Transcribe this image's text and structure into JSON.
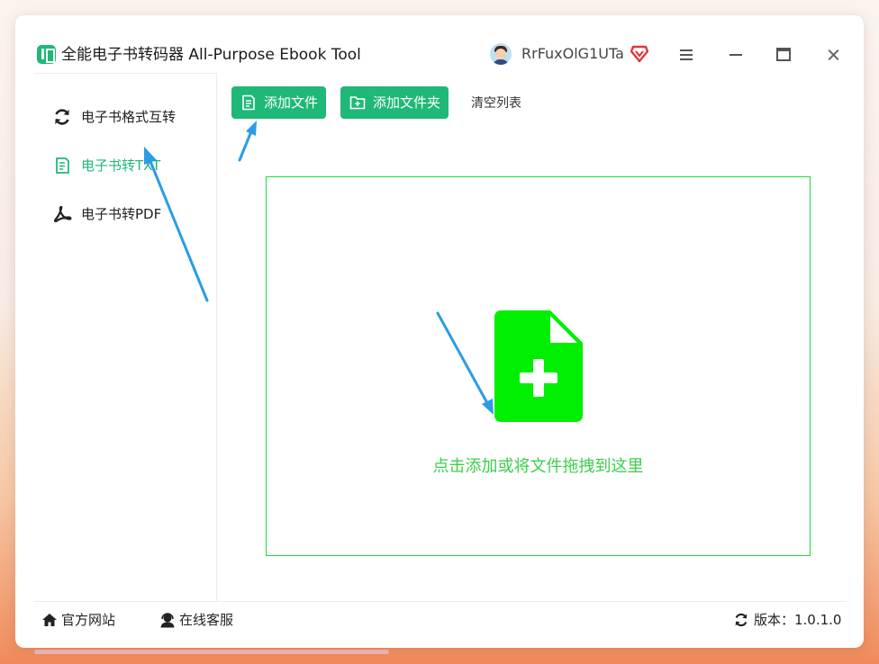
{
  "window": {
    "title": "全能电子书转码器 All-Purpose Ebook Tool",
    "username": "RrFuxOlG1UTa"
  },
  "sidebar": {
    "items": [
      {
        "label": "电子书格式互转",
        "icon": "refresh-icon",
        "active": false
      },
      {
        "label": "电子书转TXT",
        "icon": "document-icon",
        "active": true
      },
      {
        "label": "电子书转PDF",
        "icon": "pdf-icon",
        "active": false
      }
    ]
  },
  "toolbar": {
    "add_file_label": "添加文件",
    "add_folder_label": "添加文件夹",
    "clear_list_label": "清空列表"
  },
  "dropzone": {
    "hint": "点击添加或将文件拖拽到这里"
  },
  "footer": {
    "website_label": "官方网站",
    "support_label": "在线客服",
    "version_label": "版本：",
    "version_value": "1.0.1.0"
  },
  "colors": {
    "accent": "#1fb877",
    "drop_green": "#00ee00",
    "drop_border": "#22d83a",
    "arrow_blue": "#2b9ce6"
  }
}
